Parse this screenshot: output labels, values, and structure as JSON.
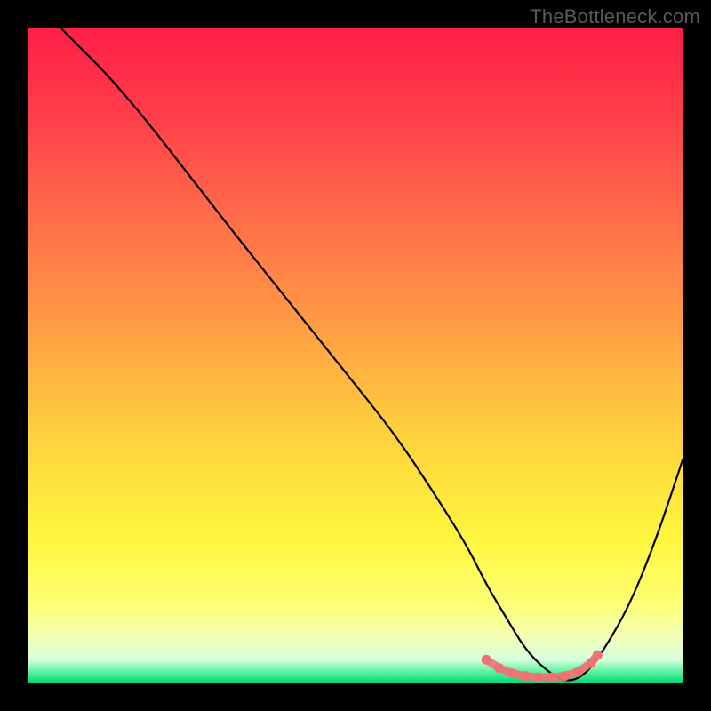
{
  "watermark": {
    "text": "TheBottleneck.com"
  },
  "chart_data": {
    "type": "line",
    "title": "",
    "xlabel": "",
    "ylabel": "",
    "xlim": [
      0,
      100
    ],
    "ylim": [
      0,
      100
    ],
    "grid": false,
    "legend": false,
    "background_gradient": {
      "stops": [
        {
          "pos": 0.0,
          "color": "#ff1f46"
        },
        {
          "pos": 0.12,
          "color": "#ff3a4a"
        },
        {
          "pos": 0.28,
          "color": "#ff6a4a"
        },
        {
          "pos": 0.45,
          "color": "#ff9b44"
        },
        {
          "pos": 0.62,
          "color": "#ffd13e"
        },
        {
          "pos": 0.78,
          "color": "#fff63e"
        },
        {
          "pos": 0.88,
          "color": "#fdff74"
        },
        {
          "pos": 0.93,
          "color": "#f3ffb6"
        },
        {
          "pos": 0.965,
          "color": "#d6ffdf"
        },
        {
          "pos": 0.985,
          "color": "#52f19b"
        },
        {
          "pos": 1.0,
          "color": "#00d97a"
        }
      ]
    },
    "series": [
      {
        "name": "bottleneck-curve",
        "color": "#000000",
        "x": [
          5,
          8,
          12,
          18,
          25,
          32,
          40,
          48,
          56,
          62,
          67,
          70,
          73,
          76,
          79,
          82,
          85,
          88,
          92,
          96,
          100
        ],
        "y": [
          100,
          97,
          93,
          86,
          77,
          68,
          58,
          48,
          38,
          29,
          21,
          15,
          10,
          5,
          2,
          0,
          1,
          5,
          12,
          22,
          34
        ]
      }
    ],
    "markers": {
      "name": "optimal-range",
      "color": "#ef7272",
      "points": [
        {
          "x": 70,
          "y": 3.5
        },
        {
          "x": 72,
          "y": 2.2
        },
        {
          "x": 74,
          "y": 1.4
        },
        {
          "x": 76,
          "y": 1.0
        },
        {
          "x": 78,
          "y": 0.8
        },
        {
          "x": 80,
          "y": 0.8
        },
        {
          "x": 82,
          "y": 1.0
        },
        {
          "x": 84,
          "y": 1.6
        },
        {
          "x": 86,
          "y": 3.0
        },
        {
          "x": 87,
          "y": 4.2
        }
      ]
    }
  }
}
